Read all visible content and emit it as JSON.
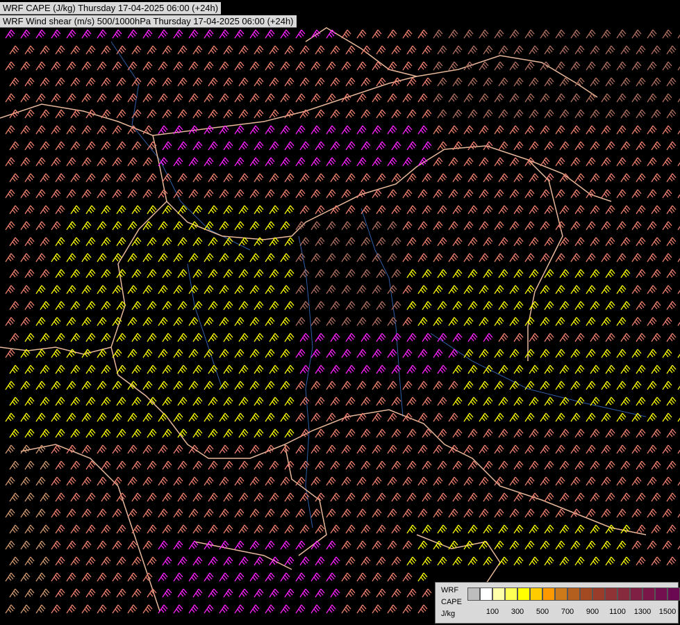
{
  "titles": {
    "line1": "WRF CAPE (J/kg) Thursday 17-04-2025 06:00 (+24h)",
    "line2": "WRF Wind shear (m/s) 500/1000hPa Thursday 17-04-2025 06:00 (+24h)"
  },
  "legend": {
    "label_model": "WRF",
    "label_field": "CAPE",
    "label_unit": "J/kg",
    "swatch_colors": [
      "#bdbdbd",
      "#ffffff",
      "#ffffaa",
      "#ffff55",
      "#ffff00",
      "#ffcc00",
      "#ff9900",
      "#cc7a1a",
      "#b45f1e",
      "#a34a22",
      "#993d2a",
      "#8f3336",
      "#882a3d",
      "#801f44",
      "#7a1648",
      "#730f4e",
      "#6b0a52"
    ],
    "ticks": [
      "100",
      "300",
      "500",
      "700",
      "900",
      "1100",
      "1300",
      "1500"
    ]
  },
  "colors": {
    "background": "#000000",
    "borders": "#e8b89a",
    "rivers": "#2f5fa8",
    "barb_magenta": "#ff22ff",
    "barb_salmon": "#f08070",
    "barb_yellow": "#ffff00",
    "barb_brown": "#b07060",
    "barb_tan": "#d09870"
  }
}
